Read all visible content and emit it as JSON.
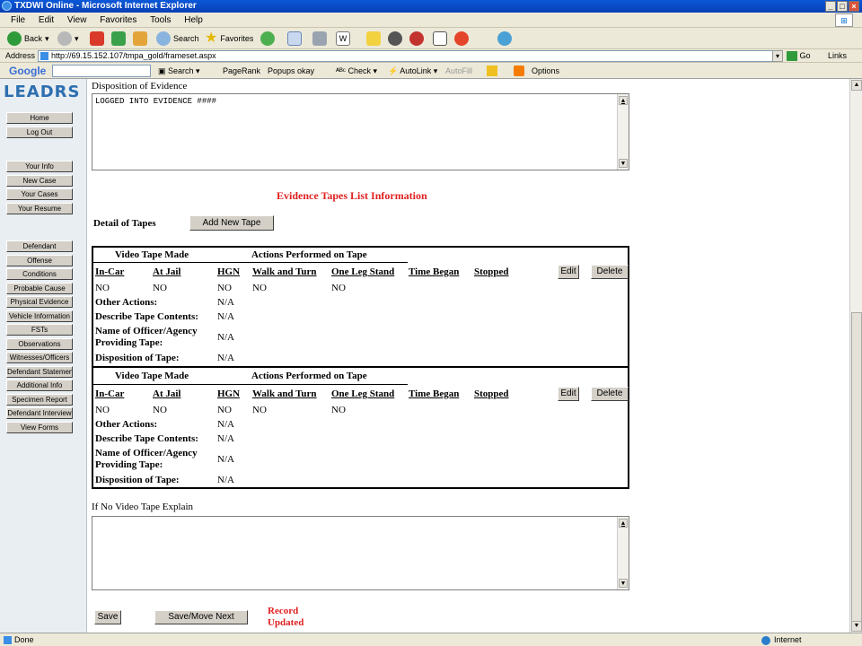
{
  "window": {
    "title": "TXDWI Online - Microsoft Internet Explorer"
  },
  "menu": [
    "File",
    "Edit",
    "View",
    "Favorites",
    "Tools",
    "Help"
  ],
  "toolbar": {
    "back": "Back",
    "search": "Search",
    "favorites": "Favorites"
  },
  "address": {
    "label": "Address",
    "url": "http://69.15.152.107/tmpa_gold/frameset.aspx",
    "go": "Go",
    "links": "Links"
  },
  "google_bar": {
    "brand": "Google",
    "search": "Search",
    "pagerank": "PageRank",
    "popups": "Popups okay",
    "check": "Check",
    "autolink": "AutoLink",
    "autofill": "AutoFill",
    "options": "Options"
  },
  "sidebar": {
    "logo": "LEADRS",
    "items": [
      "Home",
      "Log Out",
      "Your Info",
      "New Case",
      "Your Cases",
      "Your Resume",
      "Defendant",
      "Offense",
      "Conditions",
      "Probable Cause",
      "Physical Evidence",
      "Vehicle Information",
      "FSTs",
      "Observations",
      "Witnesses/Officers",
      "Defendant Statement",
      "Additional Info",
      "Specimen Report",
      "Defendant Interview",
      "View Forms"
    ]
  },
  "main": {
    "disposition_label": "Disposition of Evidence",
    "disposition_value": "LOGGED INTO EVIDENCE ####",
    "section_title": "Evidence Tapes List Information",
    "detail_label": "Detail of Tapes",
    "add_tape_button": "Add New Tape",
    "headers": {
      "video_made": "Video Tape Made",
      "actions": "Actions Performed on Tape",
      "in_car": "In-Car",
      "at_jail": "At Jail",
      "hgn": "HGN",
      "walk_turn": "Walk and Turn",
      "one_leg": "One Leg Stand",
      "time_began": "Time Began",
      "stopped": "Stopped"
    },
    "row_labels": {
      "other_actions": "Other Actions:",
      "describe": "Describe Tape Contents:",
      "officer_1": "Name of Officer/Agency",
      "officer_2": "Providing Tape:",
      "disposition": "Disposition of Tape:"
    },
    "edit_button": "Edit",
    "delete_button": "Delete",
    "tapes": [
      {
        "in_car": "NO",
        "at_jail": "NO",
        "hgn": "NO",
        "walk_turn": "NO",
        "one_leg": "NO",
        "other_actions": "N/A",
        "describe": "N/A",
        "officer": "N/A",
        "disposition": "N/A"
      },
      {
        "in_car": "NO",
        "at_jail": "NO",
        "hgn": "NO",
        "walk_turn": "NO",
        "one_leg": "NO",
        "other_actions": "N/A",
        "describe": "N/A",
        "officer": "N/A",
        "disposition": "N/A"
      }
    ],
    "no_video_label": "If No Video Tape Explain",
    "no_video_value": "",
    "save_button": "Save",
    "save_next_button": "Save/Move Next",
    "record_line1": "Record",
    "record_line2": "Updated"
  },
  "status": {
    "left": "Done",
    "zone": "Internet"
  }
}
